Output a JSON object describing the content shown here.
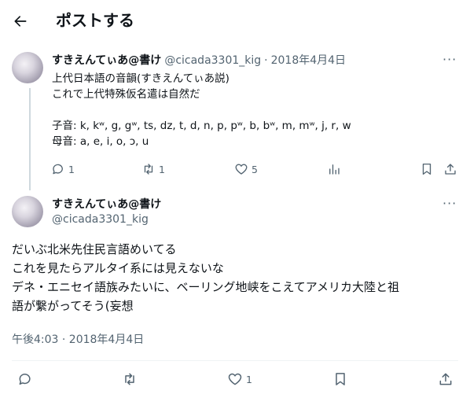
{
  "header": {
    "title": "ポストする",
    "back_icon": "arrow-left-icon"
  },
  "parent_post": {
    "display_name": "すきえんてぃあ@書け",
    "handle": "@cicada3301_kig",
    "separator": "·",
    "date": "2018年4月4日",
    "lines": [
      "上代日本語の音韻(すきえんてぃあ説)",
      "これで上代特殊仮名遣は自然だ",
      "",
      "子音: k, kʷ, g, gʷ, ts, dz, t, d, n, p, pʷ, b, bʷ, m, mʷ, j, r, w",
      "母音: a, e, i, o, ɔ, u"
    ],
    "actions": {
      "reply_count": "1",
      "repost_count": "1",
      "like_count": "5"
    }
  },
  "main_post": {
    "display_name": "すきえんてぃあ@書け",
    "handle": "@cicada3301_kig",
    "lines": [
      "だいぶ北米先住民言語めいてる",
      "これを見たらアルタイ系には見えないな",
      "デネ・エニセイ語族みたいに、ベーリング地峡をこえてアメリカ大陸と祖",
      "語が繋がってそう(妄想"
    ],
    "timestamp": "午後4:03 · 2018年4月4日",
    "actions": {
      "like_count": "1"
    }
  },
  "colors": {
    "text": "#0f1419",
    "muted": "#536471",
    "divider": "#eff3f4",
    "thread_line": "#cfd9de"
  }
}
